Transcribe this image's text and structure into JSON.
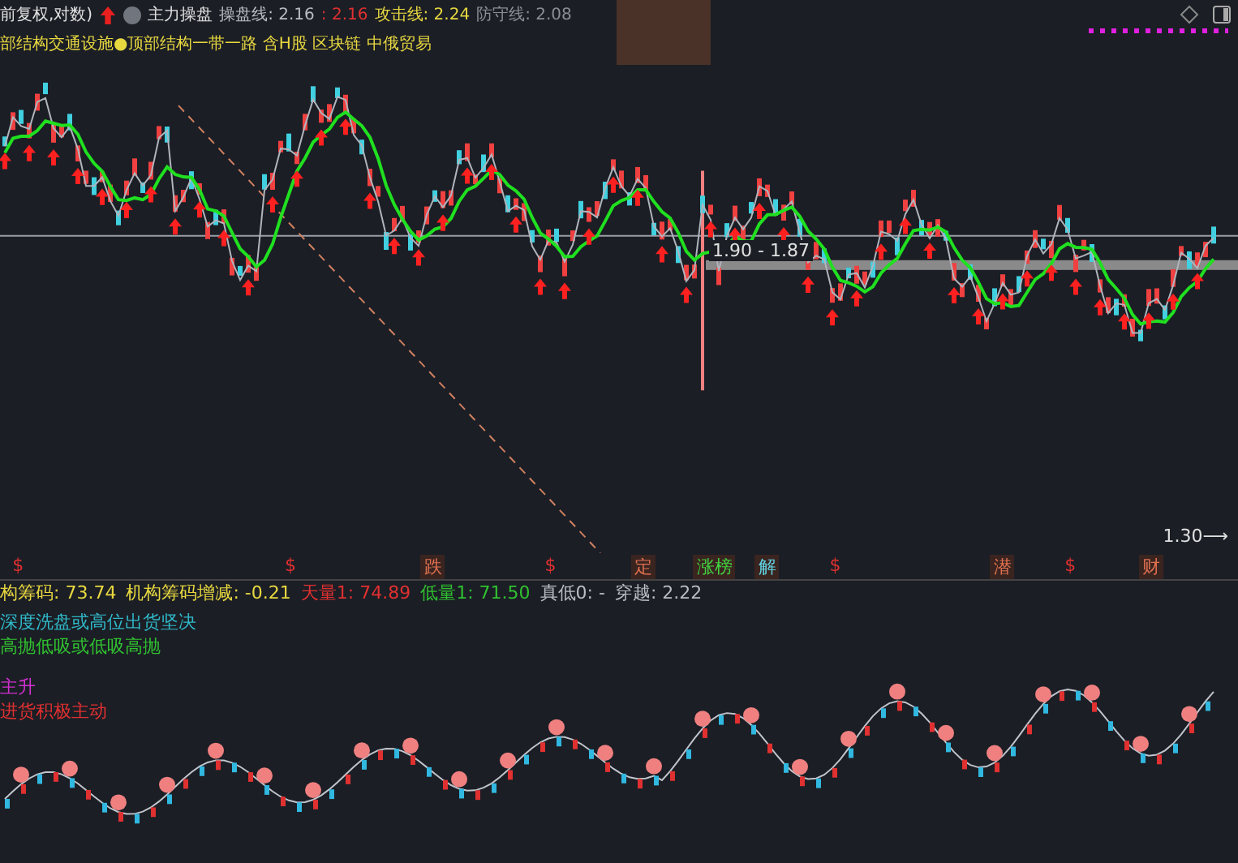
{
  "header": {
    "title": "前复权,对数)",
    "indicator": "主力操盘",
    "legend": [
      {
        "text": "操盘线: 2.16",
        "color": "#b8bcc4"
      },
      {
        "text": ": 2.16",
        "color": "#e03030"
      },
      {
        "text": "攻击线: 2.24",
        "color": "#e8d840"
      },
      {
        "text": "防守线: 2.08",
        "color": "#8a8f98"
      }
    ]
  },
  "concepts": "部结构交通设施●顶部结构一带一路 含H股 区块链 中俄贸易",
  "main_chart": {
    "range_label": "1.90 - 1.87",
    "low_label": "1.30⟶"
  },
  "events": [
    {
      "text": "$",
      "kind": "dollar"
    },
    {
      "text": "$",
      "kind": "dollar"
    },
    {
      "text": "跌",
      "kind": "tag"
    },
    {
      "text": "$",
      "kind": "dollar"
    },
    {
      "text": "定",
      "kind": "tag"
    },
    {
      "text": "涨榜",
      "kind": "tag"
    },
    {
      "text": "解",
      "kind": "tag"
    },
    {
      "text": "$",
      "kind": "dollar"
    },
    {
      "text": "潜",
      "kind": "tag"
    },
    {
      "text": "$",
      "kind": "dollar"
    },
    {
      "text": "财",
      "kind": "tag"
    }
  ],
  "indicator_legend": [
    {
      "text": "构筹码: 73.74",
      "color": "#e8d840"
    },
    {
      "text": "机构筹码增减: -0.21",
      "color": "#e8d840"
    },
    {
      "text": "天量1: 74.89",
      "color": "#e03030"
    },
    {
      "text": "低量1: 71.50",
      "color": "#30c030"
    },
    {
      "text": "真低0: -",
      "color": "#b8bcc4"
    },
    {
      "text": "穿越: 2.22",
      "color": "#b8bcc4"
    }
  ],
  "indicator_notes": [
    {
      "text": "深度洗盘或高位出货坚决",
      "color": "#30b8c8"
    },
    {
      "text": "高抛低吸或低吸高抛",
      "color": "#30c030"
    },
    {
      "text": "主升",
      "color": "#d030d0"
    },
    {
      "text": "进货积极主动",
      "color": "#e03030"
    }
  ]
}
